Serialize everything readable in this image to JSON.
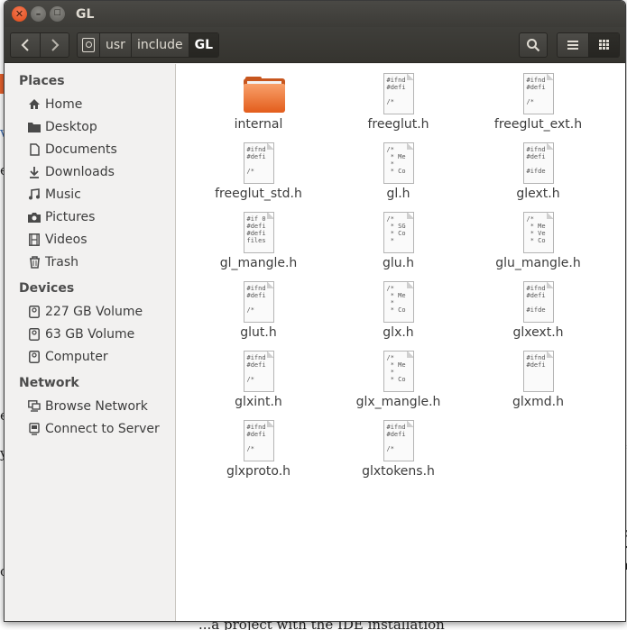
{
  "window": {
    "title": "GL"
  },
  "background": {
    "snippets": [
      "t",
      "ev",
      "c",
      "r",
      "a",
      "a",
      "d",
      "v",
      "e",
      "en",
      "yer",
      "co",
      "...a project with the IDE installation"
    ]
  },
  "toolbar": {
    "breadcrumbs": [
      {
        "label": "usr"
      },
      {
        "label": "include"
      },
      {
        "label": "GL"
      }
    ]
  },
  "sidebar": {
    "sections": [
      {
        "title": "Places",
        "items": [
          {
            "label": "Home",
            "icon": "home-icon"
          },
          {
            "label": "Desktop",
            "icon": "folder-icon"
          },
          {
            "label": "Documents",
            "icon": "document-icon"
          },
          {
            "label": "Downloads",
            "icon": "download-icon"
          },
          {
            "label": "Music",
            "icon": "music-icon"
          },
          {
            "label": "Pictures",
            "icon": "camera-icon"
          },
          {
            "label": "Videos",
            "icon": "film-icon"
          },
          {
            "label": "Trash",
            "icon": "trash-icon"
          }
        ]
      },
      {
        "title": "Devices",
        "items": [
          {
            "label": "227 GB Volume",
            "icon": "drive-icon"
          },
          {
            "label": "63 GB Volume",
            "icon": "drive-icon"
          },
          {
            "label": "Computer",
            "icon": "drive-icon"
          }
        ]
      },
      {
        "title": "Network",
        "items": [
          {
            "label": "Browse Network",
            "icon": "network-icon"
          },
          {
            "label": "Connect to Server",
            "icon": "server-icon"
          }
        ]
      }
    ]
  },
  "files": [
    {
      "name": "internal",
      "type": "folder",
      "preview": ""
    },
    {
      "name": "freeglut.h",
      "type": "header",
      "preview": "#ifnd\n#defi\n\n/*"
    },
    {
      "name": "freeglut_ext.h",
      "type": "header",
      "preview": "#ifnd\n#defi\n\n/*"
    },
    {
      "name": "freeglut_std.h",
      "type": "header",
      "preview": "#ifnd\n#defi\n\n/*"
    },
    {
      "name": "gl.h",
      "type": "header",
      "preview": "/*\n * Me\n *\n * Co"
    },
    {
      "name": "glext.h",
      "type": "header",
      "preview": "#ifnd\n#defi\n\n#ifde"
    },
    {
      "name": "gl_mangle.h",
      "type": "header",
      "preview": "#if 0\n#defi\n#defi\nfiles"
    },
    {
      "name": "glu.h",
      "type": "header",
      "preview": "/*\n * SG\n * Co\n *"
    },
    {
      "name": "glu_mangle.h",
      "type": "header",
      "preview": "/*\n * Me\n * Ve\n * Co"
    },
    {
      "name": "glut.h",
      "type": "header",
      "preview": "#ifnd\n#defi\n\n/*"
    },
    {
      "name": "glx.h",
      "type": "header",
      "preview": "/*\n * Me\n *\n * Co"
    },
    {
      "name": "glxext.h",
      "type": "header",
      "preview": "#ifnd\n#defi\n\n#ifde"
    },
    {
      "name": "glxint.h",
      "type": "header",
      "preview": "#ifnd\n#defi\n\n/*"
    },
    {
      "name": "glx_mangle.h",
      "type": "header",
      "preview": "/*\n * Me\n *\n * Co"
    },
    {
      "name": "glxmd.h",
      "type": "header",
      "preview": "#ifnd\n#defi\n\n"
    },
    {
      "name": "glxproto.h",
      "type": "header",
      "preview": "#ifnd\n#defi\n\n/*"
    },
    {
      "name": "glxtokens.h",
      "type": "header",
      "preview": "#ifnd\n#defi\n\n/*"
    }
  ]
}
